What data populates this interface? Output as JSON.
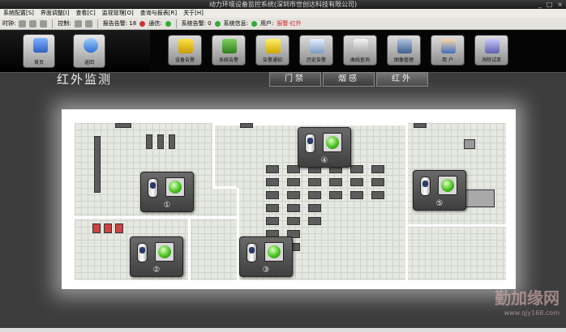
{
  "window": {
    "title": "动力环境设备监控系统(深圳市世创达科技有限公司)",
    "controls": [
      "_",
      "□",
      "×"
    ]
  },
  "menu": [
    "系统配置[S]",
    "界面调整[I]",
    "查看[C]",
    "监视管理[O]",
    "查询与报表[R]",
    "关于[H]"
  ],
  "toolbar": {
    "time_label": "时钟:",
    "ctrl_label": "控制:",
    "alarm_label": "报告告警: 18",
    "comm_label": "通信:",
    "system_label": "系统告警: 0",
    "system_msg_label": "系统信息:",
    "user_label": "用户:",
    "alert_text": "报警·红外"
  },
  "nav": {
    "home": "首页",
    "back": "返回",
    "items": [
      "设备告警",
      "系统告警",
      "告警通知",
      "历史告警",
      "曲线查询",
      "图像管理",
      "用 户",
      "消除试单"
    ]
  },
  "page": {
    "title": "红外监测"
  },
  "tabs": [
    "门禁",
    "烟感",
    "红外"
  ],
  "active_tab": 2,
  "sensors": [
    {
      "num": "①",
      "state": "normal"
    },
    {
      "num": "②",
      "state": "normal"
    },
    {
      "num": "③",
      "state": "normal"
    },
    {
      "num": "④",
      "state": "normal"
    },
    {
      "num": "⑤",
      "state": "normal"
    }
  ],
  "watermark": {
    "brand": "勤加缘网",
    "url": "www.qjy168.com"
  }
}
